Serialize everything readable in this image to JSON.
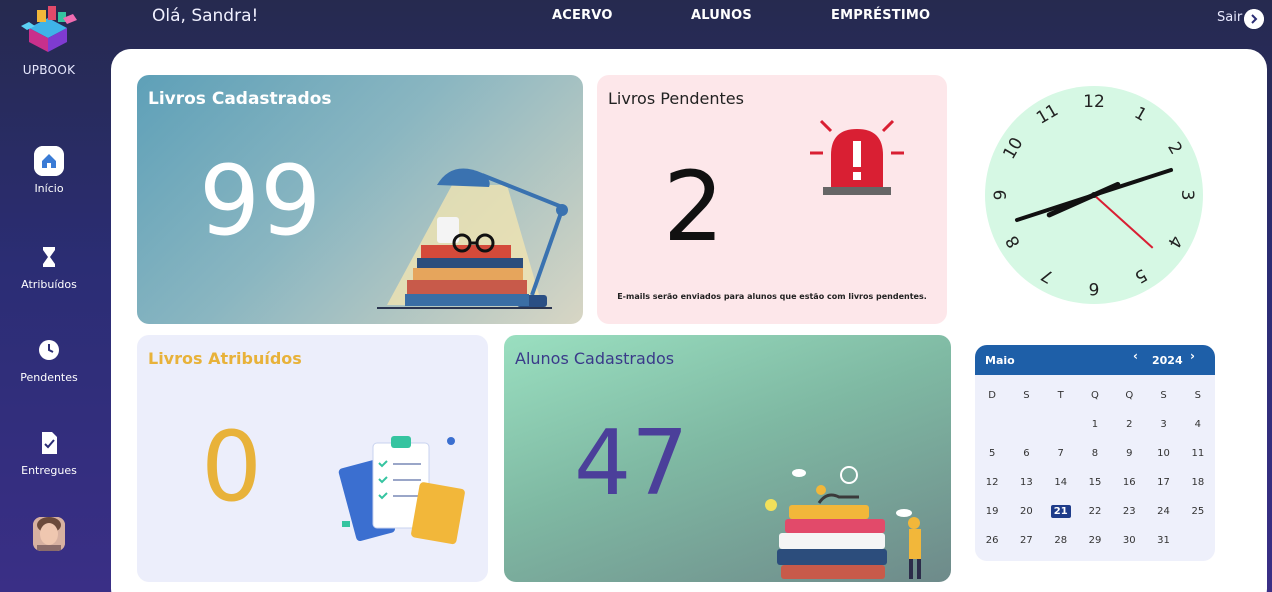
{
  "app": {
    "brand": "UPBOOK",
    "greeting": "Olá, Sandra!",
    "logout_label": "Sair"
  },
  "topnav": [
    "ACERVO",
    "ALUNOS",
    "EMPRÉSTIMO"
  ],
  "sidebar": {
    "items": [
      {
        "label": "Início",
        "icon": "home-icon",
        "active": true
      },
      {
        "label": "Atribuídos",
        "icon": "hourglass-icon"
      },
      {
        "label": "Pendentes",
        "icon": "clock-icon"
      },
      {
        "label": "Entregues",
        "icon": "checked-document-icon"
      }
    ]
  },
  "cards": {
    "livros_cadastrados": {
      "title": "Livros Cadastrados",
      "value": "99"
    },
    "livros_pendentes": {
      "title": "Livros Pendentes",
      "value": "2",
      "note": "E-mails serão enviados para alunos que estão com livros pendentes."
    },
    "livros_atribuidos": {
      "title": "Livros Atribuídos",
      "value": "0"
    },
    "alunos_cadastrados": {
      "title": "Alunos Cadastrados",
      "value": "47"
    }
  },
  "clock": {
    "numbers": [
      "12",
      "1",
      "2",
      "3",
      "4",
      "5",
      "6",
      "7",
      "8",
      "9",
      "10",
      "11"
    ],
    "hour": 8,
    "minute": 12,
    "second": 22
  },
  "calendar": {
    "month": "Maio",
    "year": "2024",
    "weekdays": [
      "D",
      "S",
      "T",
      "Q",
      "Q",
      "S",
      "S"
    ],
    "weeks": [
      [
        "",
        "",
        "",
        "1",
        "2",
        "3",
        "4"
      ],
      [
        "5",
        "6",
        "7",
        "8",
        "9",
        "10",
        "11"
      ],
      [
        "12",
        "13",
        "14",
        "15",
        "16",
        "17",
        "18"
      ],
      [
        "19",
        "20",
        "21",
        "22",
        "23",
        "24",
        "25"
      ],
      [
        "26",
        "27",
        "28",
        "29",
        "30",
        "31",
        ""
      ]
    ],
    "today": "21"
  },
  "colors": {
    "accent": "#1e5fa8",
    "atribuidos": "#e8b23a",
    "alunos": "#4b3f9a",
    "pendentes_alert": "#d91f33"
  }
}
